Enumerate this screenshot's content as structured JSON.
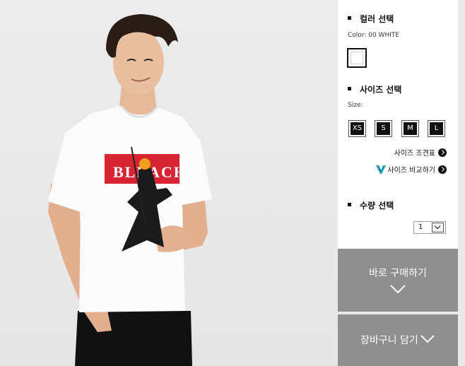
{
  "color_section": {
    "title": "컬러 선택",
    "current_label": "Color: 00 WHITE",
    "swatch_color": "#ffffff"
  },
  "size_section": {
    "title": "사이즈 선택",
    "size_label": "Size:",
    "sizes": [
      "XS",
      "S",
      "M",
      "L"
    ],
    "chart_link": "사이즈 조견표",
    "compare_link": "사이즈 비교하기"
  },
  "qty_section": {
    "title": "수량 선택",
    "value": "1"
  },
  "buy_button": {
    "label": "바로 구매하기"
  },
  "cart_button": {
    "label": "장바구니 담기"
  },
  "product_print": {
    "text": "BLEACH",
    "band_color": "#d62432"
  },
  "colors": {
    "button_bg": "#8f8f8f",
    "logo": "#1aa0b0"
  }
}
